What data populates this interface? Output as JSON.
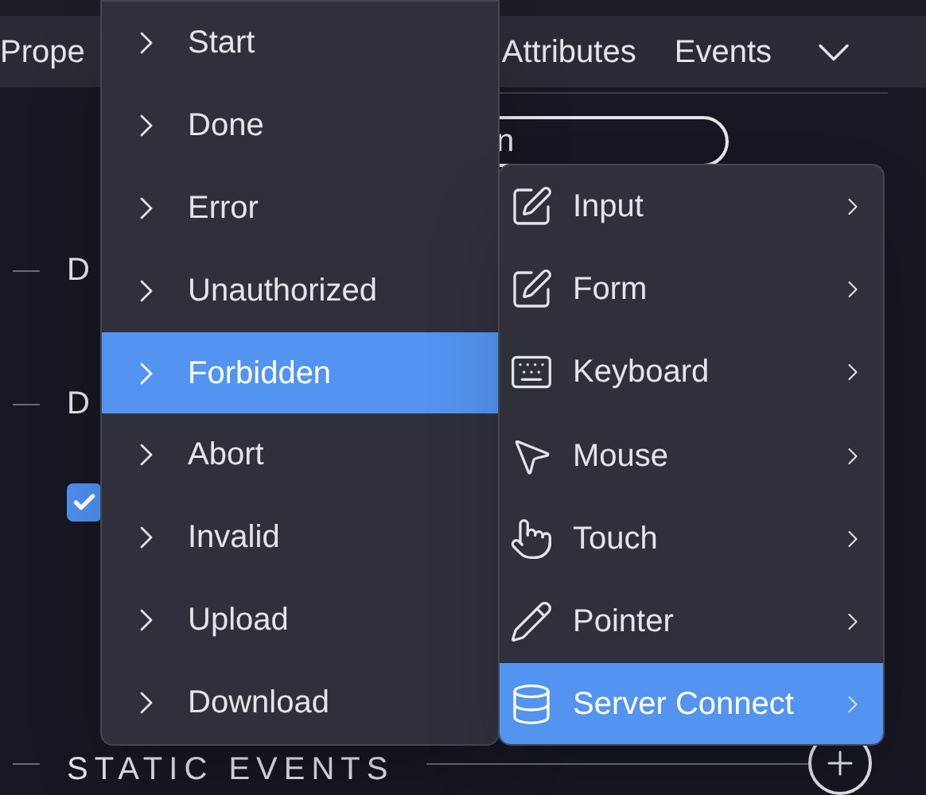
{
  "tabs": [
    {
      "label": "Prope"
    },
    {
      "label": "Attributes"
    },
    {
      "label": "Events"
    }
  ],
  "pill": {
    "text": "n"
  },
  "sections": [
    {
      "label": "D"
    },
    {
      "label": "D"
    }
  ],
  "checkbox": {
    "checked": true
  },
  "static_events": {
    "label": "STATIC EVENTS"
  },
  "event_menu": [
    {
      "label": "Start",
      "selected": false
    },
    {
      "label": "Done",
      "selected": false
    },
    {
      "label": "Error",
      "selected": false
    },
    {
      "label": "Unauthorized",
      "selected": false
    },
    {
      "label": "Forbidden",
      "selected": true
    },
    {
      "label": "Abort",
      "selected": false
    },
    {
      "label": "Invalid",
      "selected": false
    },
    {
      "label": "Upload",
      "selected": false
    },
    {
      "label": "Download",
      "selected": false
    }
  ],
  "category_menu": [
    {
      "label": "Input",
      "selected": false
    },
    {
      "label": "Form",
      "selected": false
    },
    {
      "label": "Keyboard",
      "selected": false
    },
    {
      "label": "Mouse",
      "selected": false
    },
    {
      "label": "Touch",
      "selected": false
    },
    {
      "label": "Pointer",
      "selected": false
    },
    {
      "label": "Server Connect",
      "selected": true
    }
  ]
}
